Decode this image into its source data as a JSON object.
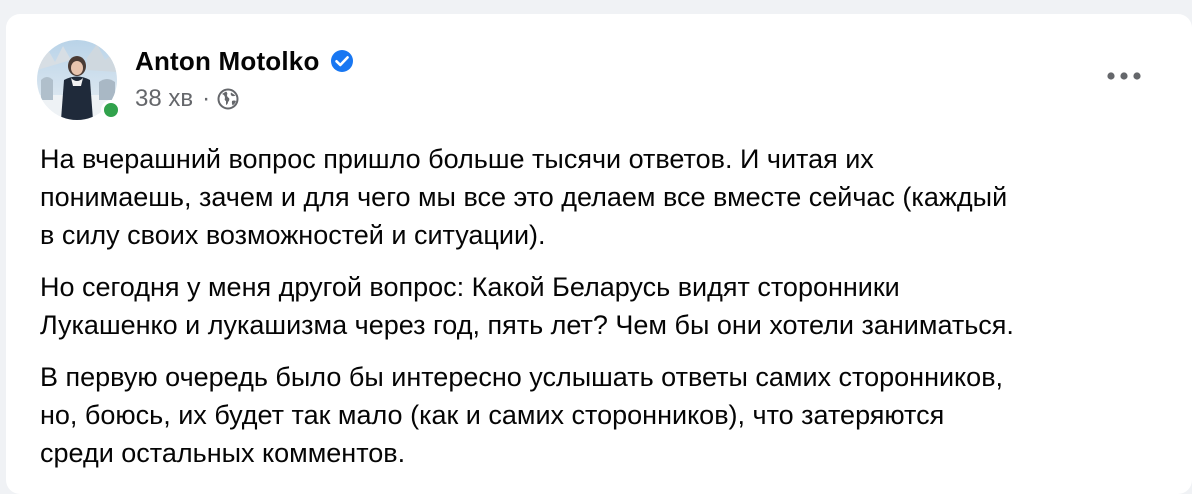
{
  "post": {
    "author": "Anton Motolko",
    "verified": true,
    "timestamp": "38 хв",
    "separator": "·",
    "privacy_icon": "globe-icon",
    "more_icon": "more-horizontal-icon",
    "paragraphs": [
      "На вчерашний вопрос пришло больше тысячи ответов. И читая их\nпонимаешь, зачем и для чего мы все это делаем все вместе сейчас (каждый\nв силу своих возможностей и ситуации).",
      "Но сегодня у меня другой вопрос: Какой Беларусь видят сторонники\nЛукашенко и лукашизма через год, пять лет? Чем бы они хотели заниматься.",
      "В первую очередь было бы интересно услышать ответы самих сторонников,\nно, боюсь, их будет так мало (как и самих сторонников), что затеряются\nсреди остальных комментов."
    ]
  },
  "colors": {
    "background": "#f0f2f5",
    "card": "#ffffff",
    "text_primary": "#050505",
    "text_secondary": "#65676b",
    "verified_blue": "#1877f2",
    "online_green": "#31a24c"
  }
}
